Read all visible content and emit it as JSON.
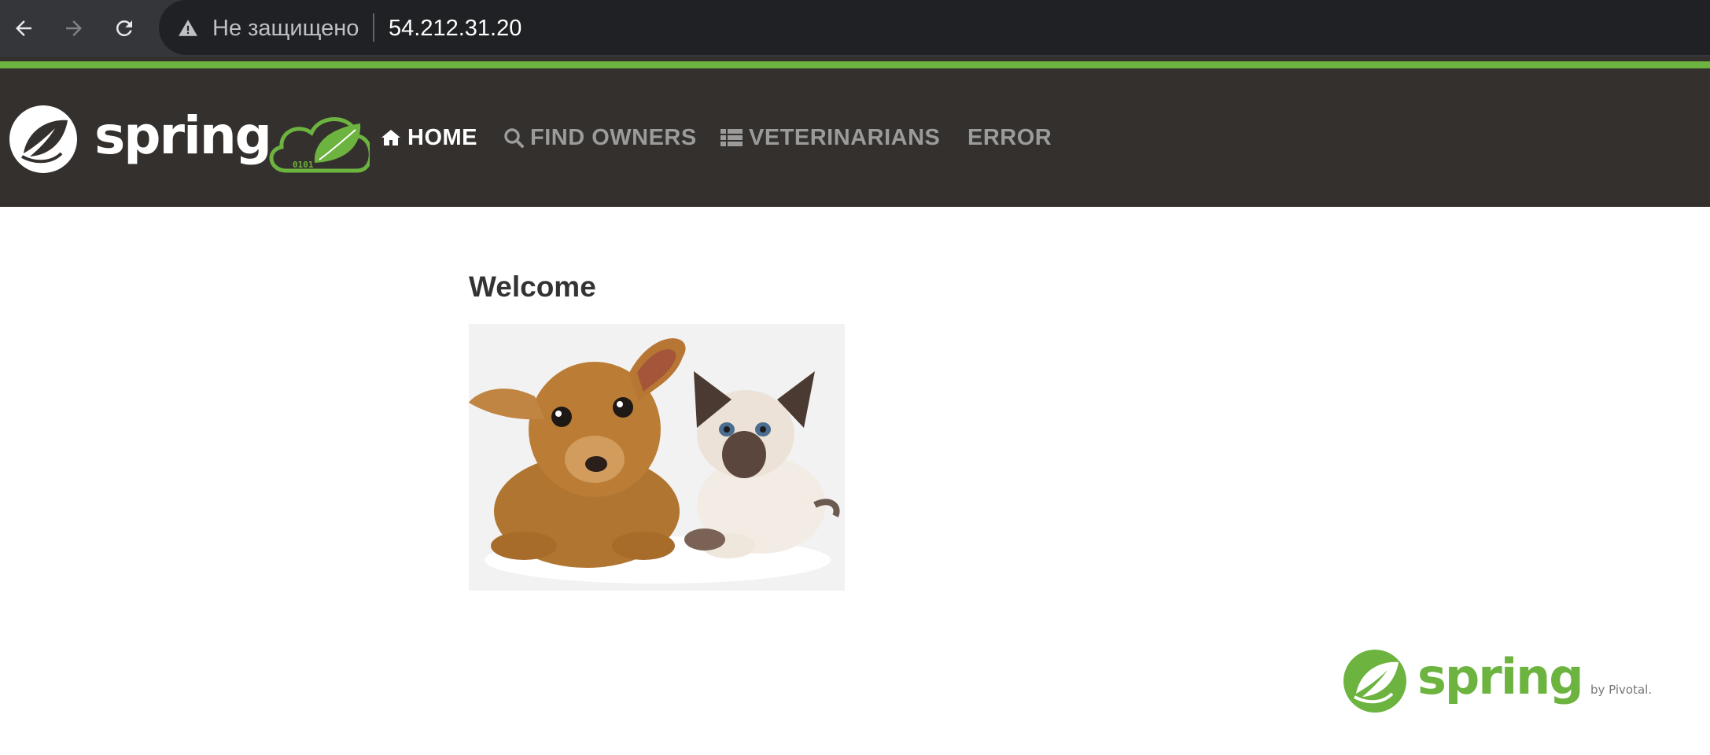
{
  "browser": {
    "back_icon": "arrow-left-icon",
    "forward_icon": "arrow-right-icon",
    "reload_icon": "reload-icon",
    "security_icon": "warning-triangle-icon",
    "security_label": "Не защищено",
    "url": "54.212.31.20"
  },
  "navbar": {
    "brand_logo": "spring-petclinic-logo",
    "items": [
      {
        "label": "HOME",
        "icon": "home-icon",
        "active": true
      },
      {
        "label": "FIND OWNERS",
        "icon": "search-icon",
        "active": false
      },
      {
        "label": "VETERINARIANS",
        "icon": "list-icon",
        "active": false
      },
      {
        "label": "ERROR",
        "icon": "",
        "active": false
      }
    ]
  },
  "main": {
    "heading": "Welcome",
    "image": "pets-image"
  },
  "footer": {
    "logo": "spring-by-pivotal-logo",
    "logo_text": "spring",
    "logo_byline": "by Pivotal."
  },
  "colors": {
    "brand_green": "#6db33f",
    "navbar_bg": "#34302d",
    "nav_text": "#9b9b9b",
    "nav_active": "#ffffff",
    "heading": "#333333"
  }
}
